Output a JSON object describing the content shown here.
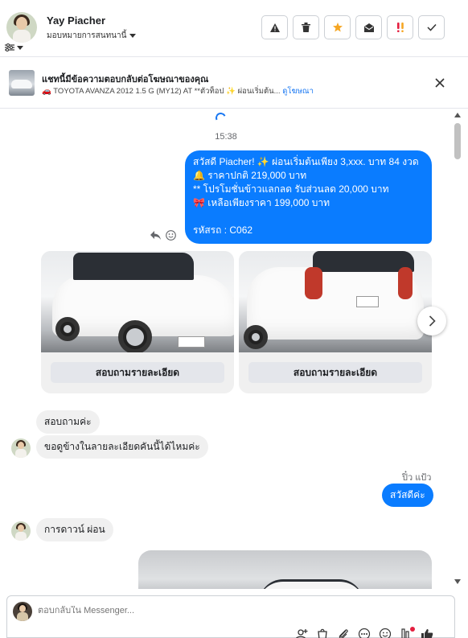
{
  "header": {
    "user_name": "Yay Piacher",
    "assign_label": "มอบหมายการสนทนานี้",
    "actions": [
      "warning-icon",
      "trash-icon",
      "star-icon",
      "envelope-open-icon",
      "double-exclamation-icon",
      "check-icon"
    ]
  },
  "ad_banner": {
    "title": "แชทนี้มีข้อความตอบกลับต่อโฆษณาของคุณ",
    "subtitle": "🚗 TOYOTA AVANZA 2012 1.5 G (MY12) AT **ตัวท็อป ✨ ผ่อนเริ่มต้น...",
    "link": "ดูโฆษณา"
  },
  "chat": {
    "timestamp": "15:38",
    "outgoing_message": {
      "lines": [
        "สวัสดี Piacher! ✨  ผ่อนเริ่มต้นเพียง 3,xxx. บาท 84 งวด",
        "🔔 ราคาปกติ 219,000 บาท",
        "** โปรโมชั่นข้าวแลกลด รับส่วนลด 20,000 บาท",
        "🎀  เหลือเพียงราคา 199,000 บาท",
        "",
        "รหัสรถ : C062"
      ]
    },
    "cards": [
      {
        "button": "สอบถามรายละเอียด"
      },
      {
        "button": "สอบถามรายละเอียด"
      }
    ],
    "incoming_1": "สอบถามค่ะ",
    "incoming_2": "ขอดูข้างในลายละเอียดคันนี้ได้ไหมค่ะ",
    "sender_label": "ปิ๋ว แป้ว",
    "outgoing_2": "สวัสดีค่ะ",
    "incoming_3": "การดาวน์ ผ่อน"
  },
  "composer": {
    "placeholder": "ตอบกลับใน Messenger..."
  },
  "colors": {
    "messenger_blue": "#0a7cff",
    "accent_orange": "#f5a623",
    "alert_red": "#e41e3f"
  }
}
